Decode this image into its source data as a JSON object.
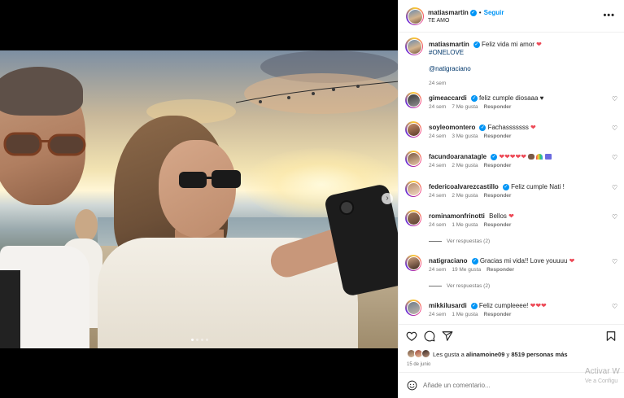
{
  "post": {
    "author": "matiasmartin",
    "follow_label": "Seguir",
    "separator": "•",
    "subtitle": "TE AMO",
    "more_icon": "more-horizontal-icon",
    "photo_description_icon": "selfie-photo",
    "next_icon": "chevron-right-icon",
    "carousel": {
      "count": 4,
      "active": 1
    }
  },
  "caption": {
    "username": "matiasmartin",
    "text": "Feliz vida mi amor",
    "hashtag": "#ONELOVE",
    "mention": "@natigraciano",
    "time": "24 sem"
  },
  "comments": [
    {
      "username": "gimeaccardi",
      "verified": true,
      "text": "feliz cumple diosaaa ♥",
      "time": "24 sem",
      "likes": "7 Me gusta",
      "reply": "Responder"
    },
    {
      "username": "soyleomontero",
      "verified": true,
      "text": "Fachasssssss",
      "heart": "❤",
      "time": "24 sem",
      "likes": "3 Me gusta",
      "reply": "Responder"
    },
    {
      "username": "facundoaranatagle",
      "verified": true,
      "text": "",
      "emojis": "❤❤❤❤❤",
      "time": "24 sem",
      "likes": "2 Me gusta",
      "reply": "Responder"
    },
    {
      "username": "federicoalvarezcastillo",
      "verified": true,
      "text": "Feliz cumple Nati !",
      "time": "24 sem",
      "likes": "2 Me gusta",
      "reply": "Responder"
    },
    {
      "username": "rominamonfrinotti",
      "verified": false,
      "text": "Bellos",
      "heart": "❤",
      "time": "24 sem",
      "likes": "1 Me gusta",
      "reply": "Responder",
      "view_replies": "Ver respuestas (2)"
    },
    {
      "username": "natigraciano",
      "verified": true,
      "text": "Gracias mi vida!! Love youuuu",
      "heart": "❤",
      "time": "24 sem",
      "likes": "19 Me gusta",
      "reply": "Responder",
      "view_replies": "Ver respuestas (2)"
    },
    {
      "username": "mikkilusardi",
      "verified": true,
      "text": "Feliz cumpleeee!",
      "emojis": "❤❤❤",
      "time": "24 sem",
      "likes": "1 Me gusta",
      "reply": "Responder"
    }
  ],
  "actions": {
    "like_icon": "heart-icon",
    "comment_icon": "comment-icon",
    "share_icon": "send-icon",
    "save_icon": "bookmark-icon"
  },
  "likes": {
    "prefix": "Les gusta a ",
    "user": "alinamoine09",
    "middle": " y ",
    "count": "8519 personas más"
  },
  "date": "15 de junio",
  "add_comment": {
    "emoji_icon": "smiley-icon",
    "placeholder": "Añade un comentario..."
  },
  "watermark": {
    "line1": "Activar W",
    "line2": "Ve a Configu"
  },
  "colors": {
    "accent": "#0095f6",
    "heart": "#ed4956",
    "link": "#00376b",
    "meta": "#737373"
  }
}
